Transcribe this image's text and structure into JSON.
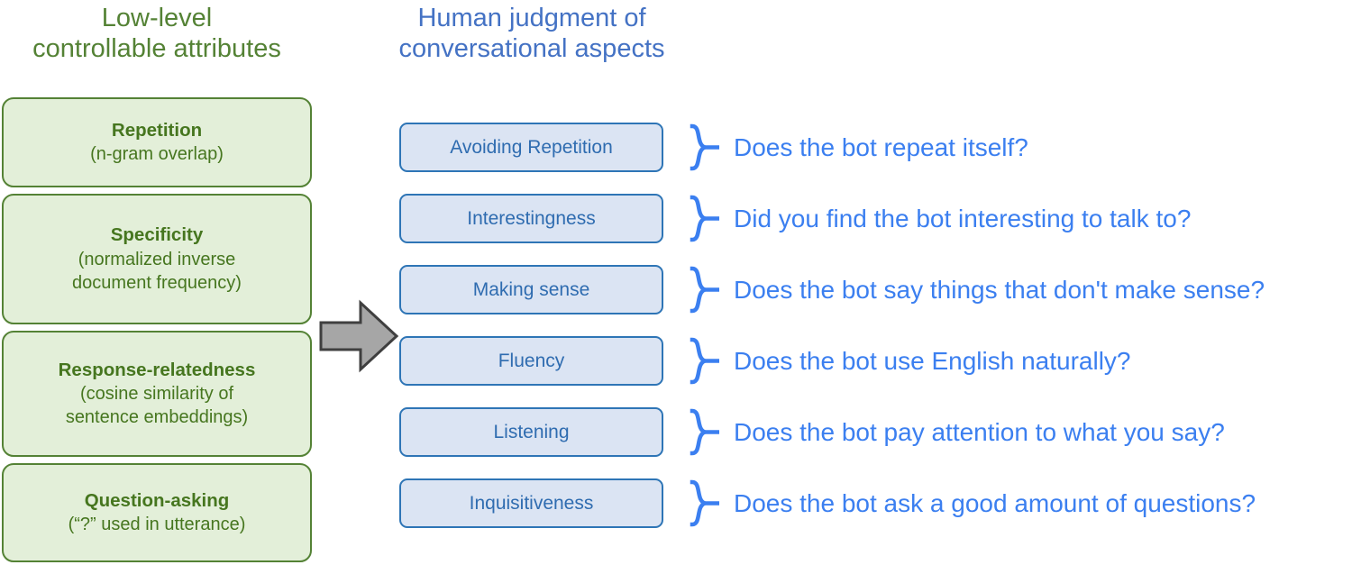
{
  "headers": {
    "left": "Low-level\ncontrollable attributes",
    "right": "Human judgment of\nconversational aspects"
  },
  "colors": {
    "green_text": "#548235",
    "green_fill": "#e3efd9",
    "green_border": "#548235",
    "blue_header": "#4472c4",
    "blue_box_fill": "#dbe4f3",
    "blue_box_border": "#2e75b6",
    "blue_box_text": "#2f6cb0",
    "question_text": "#3b7ff0",
    "arrow_fill": "#a6a6a6",
    "arrow_border": "#3f3f3f"
  },
  "attributes": [
    {
      "title": "Repetition",
      "sub": "(n-gram overlap)"
    },
    {
      "title": "Specificity",
      "sub": "(normalized inverse\ndocument frequency)"
    },
    {
      "title": "Response-relatedness",
      "sub": "(cosine similarity of\nsentence embeddings)"
    },
    {
      "title": "Question-asking",
      "sub": "(“?” used in utterance)"
    }
  ],
  "arrow": {
    "icon": "right-arrow-icon"
  },
  "aspects": [
    {
      "label": "Avoiding Repetition",
      "question": "Does the bot repeat itself?"
    },
    {
      "label": "Interestingness",
      "question": "Did you find the bot interesting to talk to?"
    },
    {
      "label": "Making sense",
      "question": "Does the bot say things that don't make sense?"
    },
    {
      "label": "Fluency",
      "question": "Does the bot use English naturally?"
    },
    {
      "label": "Listening",
      "question": "Does the bot pay attention to what you say?"
    },
    {
      "label": "Inquisitiveness",
      "question": "Does the bot ask a good amount of questions?"
    }
  ]
}
